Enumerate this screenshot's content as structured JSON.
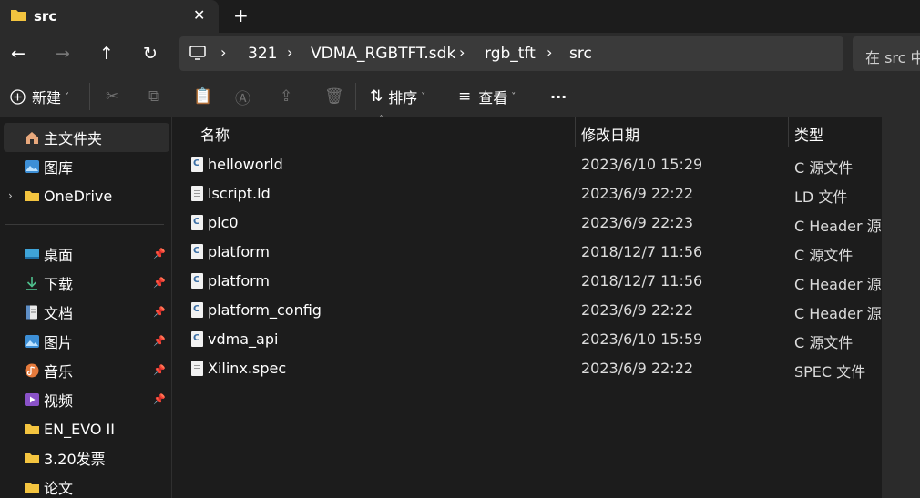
{
  "tab": {
    "title": "src",
    "close": "✕",
    "new_tab": "+"
  },
  "nav": {
    "back": "←",
    "forward": "→",
    "up": "↑",
    "refresh": "↻",
    "breadcrumbs": [
      "321",
      "VDMA_RGBTFT.sdk",
      "rgb_tft",
      "src"
    ],
    "search_placeholder": "在 src 中"
  },
  "toolbar": {
    "new_label": "新建",
    "sort_label": "排序",
    "view_label": "查看",
    "more": "···"
  },
  "sidebar": {
    "home": "主文件夹",
    "gallery": "图库",
    "onedrive": "OneDrive",
    "pinned": [
      {
        "label": "桌面",
        "icon": "desktop-icon"
      },
      {
        "label": "下载",
        "icon": "download-icon"
      },
      {
        "label": "文档",
        "icon": "documents-icon"
      },
      {
        "label": "图片",
        "icon": "pictures-icon"
      },
      {
        "label": "音乐",
        "icon": "music-icon"
      },
      {
        "label": "视频",
        "icon": "videos-icon"
      }
    ],
    "folders": [
      "EN_EVO II",
      "3.20发票",
      "论文"
    ]
  },
  "columns": {
    "name": "名称",
    "date": "修改日期",
    "type": "类型"
  },
  "files": [
    {
      "name": "helloworld",
      "date": "2023/6/10 15:29",
      "type": "C 源文件",
      "icon": "c-file-icon"
    },
    {
      "name": "lscript.ld",
      "date": "2023/6/9 22:22",
      "type": "LD 文件",
      "icon": "doc-file-icon"
    },
    {
      "name": "pic0",
      "date": "2023/6/9 22:23",
      "type": "C Header 源文件",
      "icon": "c-file-icon"
    },
    {
      "name": "platform",
      "date": "2018/12/7 11:56",
      "type": "C 源文件",
      "icon": "c-file-icon"
    },
    {
      "name": "platform",
      "date": "2018/12/7 11:56",
      "type": "C Header 源文件",
      "icon": "c-file-icon"
    },
    {
      "name": "platform_config",
      "date": "2023/6/9 22:22",
      "type": "C Header 源文件",
      "icon": "c-file-icon"
    },
    {
      "name": "vdma_api",
      "date": "2023/6/10 15:59",
      "type": "C 源文件",
      "icon": "c-file-icon"
    },
    {
      "name": "Xilinx.spec",
      "date": "2023/6/9 22:22",
      "type": "SPEC 文件",
      "icon": "doc-file-icon"
    }
  ],
  "colors": {
    "folder": "#f3c43f",
    "background": "#1c1c1c",
    "panel": "#2b2b2b"
  }
}
